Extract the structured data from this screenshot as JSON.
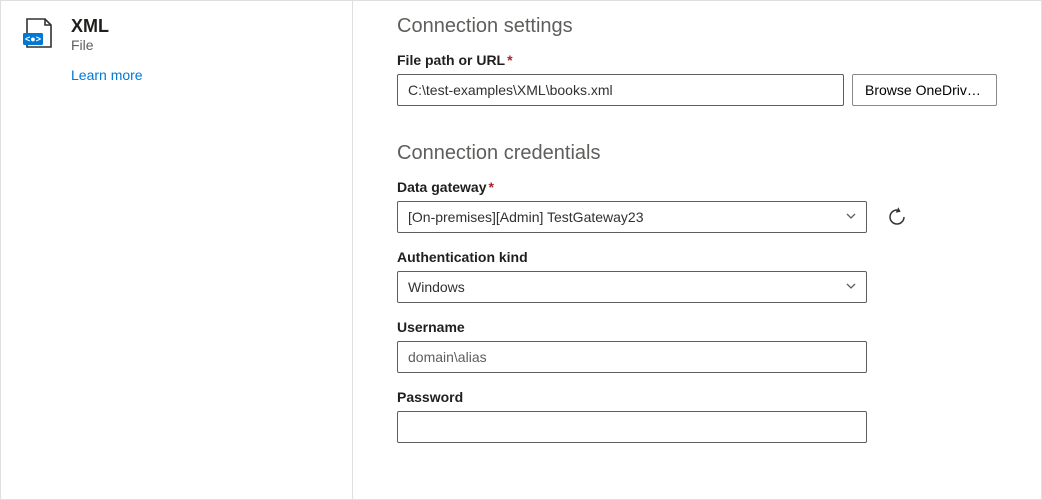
{
  "sidebar": {
    "connector_title": "XML",
    "connector_subtitle": "File",
    "learn_more": "Learn more"
  },
  "main": {
    "settings_heading": "Connection settings",
    "credentials_heading": "Connection credentials",
    "file_path": {
      "label": "File path or URL",
      "value": "C:\\test-examples\\XML\\books.xml",
      "browse_label": "Browse OneDrive..."
    },
    "gateway": {
      "label": "Data gateway",
      "value": "[On-premises][Admin] TestGateway23"
    },
    "auth_kind": {
      "label": "Authentication kind",
      "value": "Windows"
    },
    "username": {
      "label": "Username",
      "placeholder": "domain\\alias",
      "value": ""
    },
    "password": {
      "label": "Password",
      "value": ""
    }
  }
}
